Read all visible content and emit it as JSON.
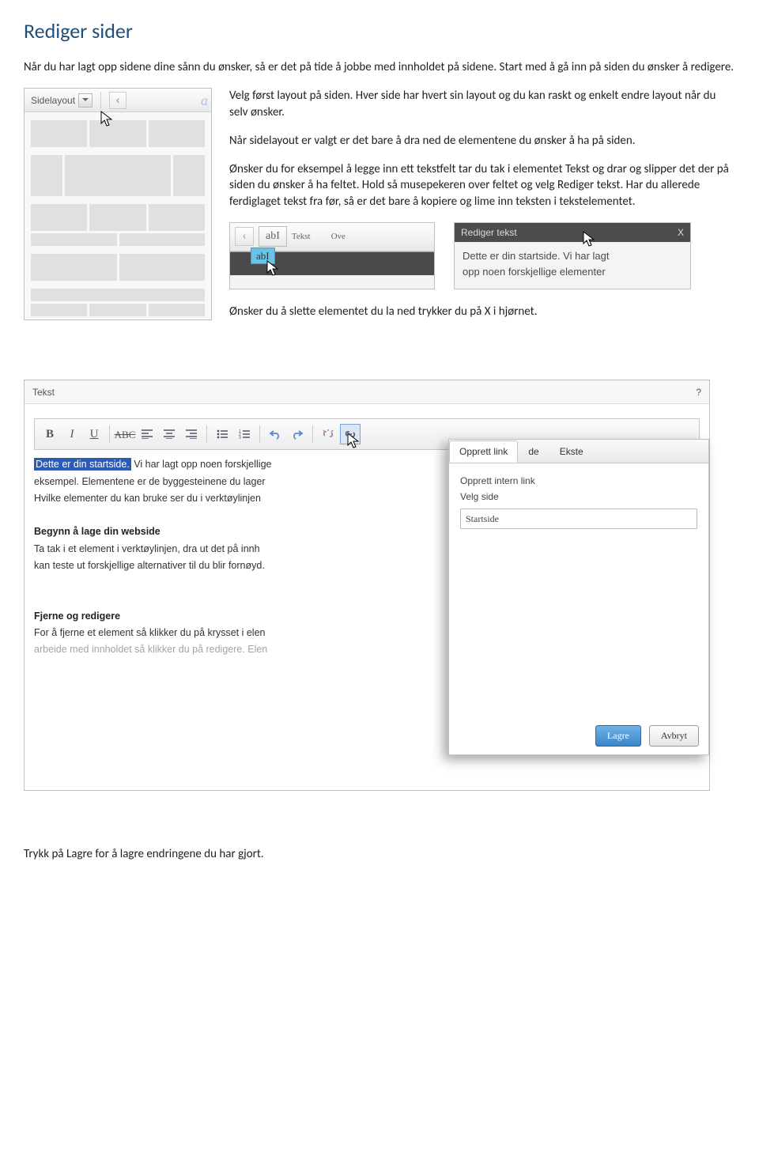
{
  "title": "Rediger sider",
  "intro": "Når du har lagt opp sidene dine sånn du ønsker, så er det på tide å jobbe med innholdet på sidene. Start med å gå inn på siden du ønsker å redigere.",
  "para1": "Velg først layout på siden. Hver side har hvert sin layout og du kan raskt og enkelt endre layout når du selv ønsker.",
  "para2": "Når sidelayout er valgt er det bare å dra ned de elementene du ønsker å ha på siden.",
  "para3": "Ønsker du for eksempel å legge inn ett tekstfelt tar du tak i elementet Tekst og drar og slipper det der på siden du ønsker å ha feltet. Hold så musepekeren over feltet og velg Rediger tekst. Har du allerede ferdiglaget tekst fra før, så er det bare å kopiere og lime inn teksten i tekstelementet.",
  "layout_dropdown_label": "Sidelayout",
  "drag_fig": {
    "element_icon_label": "abI",
    "tekst_label": "Tekst",
    "ove_label": "Ove",
    "chip": "abI"
  },
  "edit_fig": {
    "title": "Rediger tekst",
    "close": "X",
    "line1": "Dette er din startside. Vi har lagt",
    "line2": "opp noen forskjellige elementer"
  },
  "delete_note": "Ønsker du å slette elementet du la ned trykker du på X i hjørnet.",
  "editor": {
    "panel_title": "Tekst",
    "help": "?",
    "toolbar": {
      "bold": "B",
      "italic": "I",
      "underline": "U",
      "strike": "ABC"
    },
    "content": {
      "highlight": "Dette er din startside.",
      "l1_rest": " Vi har lagt opp noen forskjellige",
      "l2": "eksempel. Elementene er de byggesteinene du lager",
      "l3": "Hvilke elementer du kan bruke ser du i verktøylinjen",
      "h2": "Begynn å lage din webside",
      "l4": "Ta tak i et element i verktøylinjen, dra ut det på innh",
      "l5": "kan teste ut forskjellige alternativer til du blir fornøyd.",
      "h3": "Fjerne og redigere",
      "l6": "For å fjerne et element så klikker du på krysset i elen",
      "l7": "arbeide med innholdet så klikker du på redigere. Elen"
    },
    "popup": {
      "tab_active": "Opprett link",
      "tab2": "de",
      "tab3": "Ekste",
      "label1": "Opprett intern link",
      "label2": "Velg side",
      "selected": "Startside",
      "save": "Lagre",
      "cancel": "Avbryt"
    }
  },
  "footer": "Trykk på Lagre for å lagre endringene du har gjort."
}
